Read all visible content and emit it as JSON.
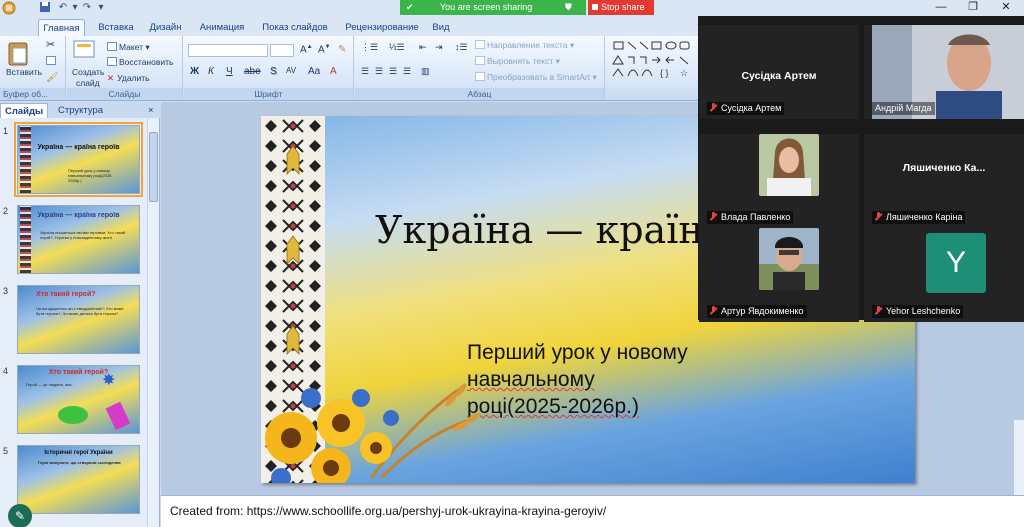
{
  "titlebar": {
    "sharing_text": "You are screen sharing",
    "stop_share": "Stop share",
    "minimize": "—",
    "maximize": "❐",
    "close": "✕"
  },
  "ribbon": {
    "tabs": [
      "Главная",
      "Вставка",
      "Дизайн",
      "Анимация",
      "Показ слайдов",
      "Рецензирование",
      "Вид"
    ],
    "clipboard": {
      "paste": "Вставить",
      "group": "Буфер об..."
    },
    "slides": {
      "create": "Создать",
      "create2": "слайд",
      "layout": "Макет",
      "restore": "Восстановить",
      "delete": "Удалить",
      "group": "Слайды"
    },
    "font": {
      "group": "Шрифт"
    },
    "paragraph": {
      "direction": "Направление текста",
      "align": "Выровнять текст",
      "smartart": "Преобразовать в SmartArt",
      "group": "Абзац"
    }
  },
  "left_panel": {
    "tab_slides": "Слайды",
    "tab_outline": "Структура",
    "close": "×",
    "thumbnails": [
      {
        "num": "1",
        "title": "Україна — країна героїв",
        "lines": "Перший урок у новому навчальному році(2025-2026р.)"
      },
      {
        "num": "2",
        "title": "Україна — країна героїв",
        "lines": "Україна пишається своїми героями; Хто такий герой?; Героїзм у повсякденному житті"
      },
      {
        "num": "3",
        "title": "Хто такий герой?",
        "lines": "Чи погоджуєтесь ви з твердженням?; Хто може бути героєм?; Чи може дитина бути героєм?"
      },
      {
        "num": "4",
        "title": "Хто такий герой?",
        "lines": "Герой — це людина, яка..."
      },
      {
        "num": "5",
        "title": "Історичні герої України",
        "lines": "Герої минулого, що створили сьогодення"
      }
    ]
  },
  "slide": {
    "title": "Україна — країна героїв",
    "subtitle_line1": "Перший урок у новому",
    "subtitle_line2": "навчальному",
    "subtitle_line3": "році(2025-2026р.)"
  },
  "notes": {
    "text": "Created from: https://www.schoollife.org.ua/pershyj-urok-ukrayina-krayina-geroyiv/"
  },
  "zoom": {
    "participants": [
      {
        "big_name": "Сусідка Артем",
        "label": "Сусідка Артем",
        "muted": true
      },
      {
        "big_name": "",
        "label": "Андрій Магда",
        "muted": false
      },
      {
        "big_name": "",
        "label": "Влада Павленко",
        "muted": true
      },
      {
        "big_name": "Ляшиченко Ка...",
        "label": "Ляшиченко Каріна",
        "muted": true
      },
      {
        "big_name": "",
        "label": "Артур Явдокименко",
        "muted": true
      },
      {
        "big_name": "",
        "label": "Yehor Leshchenko",
        "muted": true,
        "avatar_letter": "Y"
      }
    ]
  },
  "colors": {
    "share_green": "#3bb44a",
    "stop_red": "#e23a31",
    "avatar_teal": "#1e8f76"
  }
}
